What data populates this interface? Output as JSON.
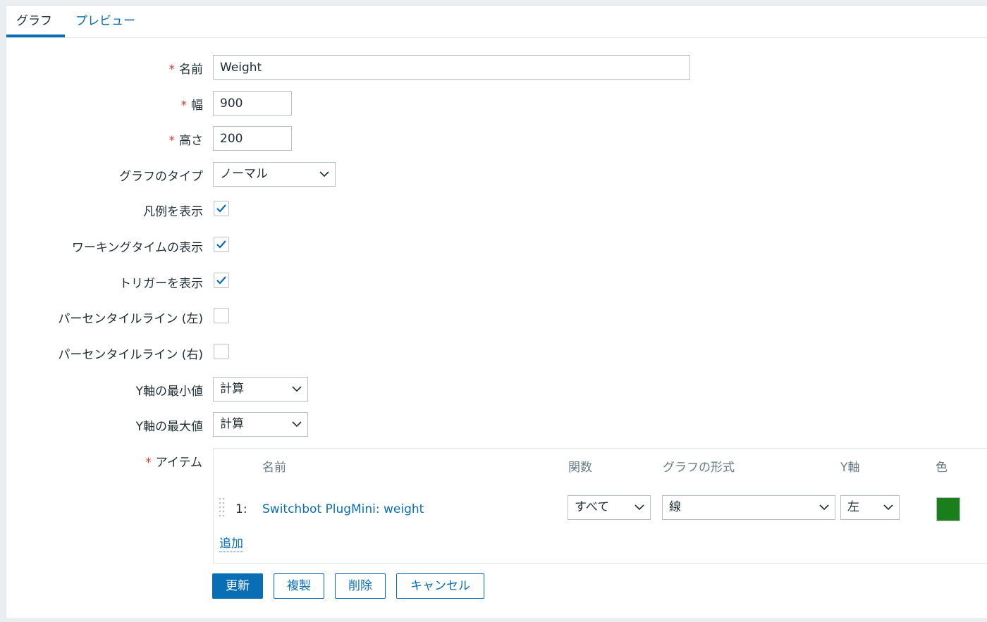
{
  "tabs": [
    {
      "label": "グラフ",
      "active": true
    },
    {
      "label": "プレビュー",
      "active": false
    }
  ],
  "form": {
    "name": {
      "label": "名前",
      "required": true,
      "value": "Weight"
    },
    "width": {
      "label": "幅",
      "required": true,
      "value": "900"
    },
    "height": {
      "label": "高さ",
      "required": true,
      "value": "200"
    },
    "graph_type": {
      "label": "グラフのタイプ",
      "value": "ノーマル"
    },
    "show_legend": {
      "label": "凡例を表示",
      "checked": true
    },
    "show_working_time": {
      "label": "ワーキングタイムの表示",
      "checked": true
    },
    "show_triggers": {
      "label": "トリガーを表示",
      "checked": true
    },
    "percentile_left": {
      "label": "パーセンタイルライン (左)",
      "checked": false
    },
    "percentile_right": {
      "label": "パーセンタイルライン (右)",
      "checked": false
    },
    "y_min": {
      "label": "Y軸の最小値",
      "value": "計算"
    },
    "y_max": {
      "label": "Y軸の最大値",
      "value": "計算"
    },
    "items": {
      "label": "アイテム",
      "required": true,
      "columns": {
        "name": "名前",
        "function": "関数",
        "draw_style": "グラフの形式",
        "y_axis": "Y軸",
        "color": "色"
      },
      "rows": [
        {
          "index": "1:",
          "name": "Switchbot PlugMini: weight",
          "function": "すべて",
          "draw_style": "線",
          "y_axis": "左",
          "color": "#1a7f1a"
        }
      ],
      "add_label": "追加"
    }
  },
  "buttons": {
    "update": "更新",
    "clone": "複製",
    "delete": "削除",
    "cancel": "キャンセル"
  },
  "colors": {
    "accent": "#0a6eb4",
    "required": "#e33734",
    "item_color": "#1a7f1a"
  }
}
